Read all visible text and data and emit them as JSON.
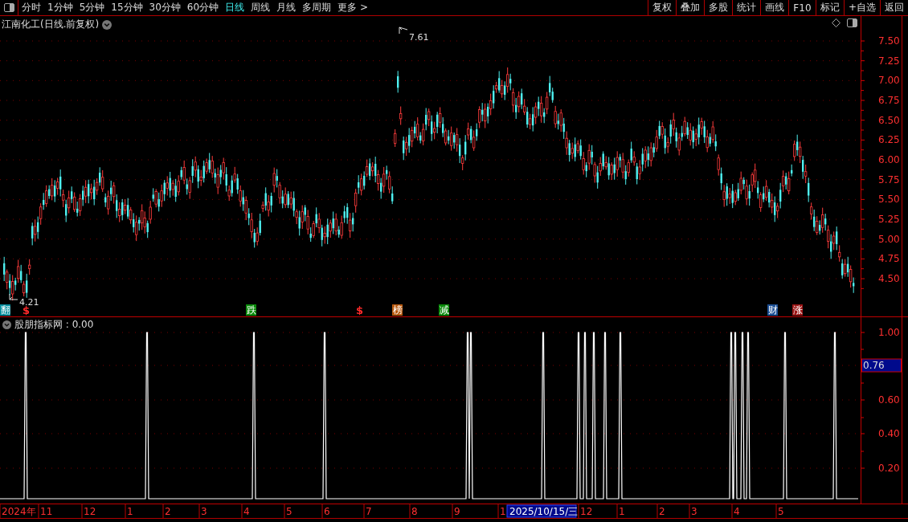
{
  "toolbar": {
    "periods": [
      {
        "label": "分时",
        "selected": false
      },
      {
        "label": "1分钟",
        "selected": false
      },
      {
        "label": "5分钟",
        "selected": false
      },
      {
        "label": "15分钟",
        "selected": false
      },
      {
        "label": "30分钟",
        "selected": false
      },
      {
        "label": "60分钟",
        "selected": false
      },
      {
        "label": "日线",
        "selected": true
      },
      {
        "label": "周线",
        "selected": false
      },
      {
        "label": "月线",
        "selected": false
      },
      {
        "label": "多周期",
        "selected": false
      },
      {
        "label": "更多 >",
        "selected": false
      }
    ],
    "buttons": [
      "复权",
      "叠加",
      "多股",
      "统计",
      "画线",
      "F10",
      "标记",
      "+自选",
      "返回"
    ]
  },
  "price_chart": {
    "title": "江南化工(日线.前复权)",
    "high_label": "7.61",
    "low_label": "4.21",
    "axis_labels": [
      "7.50",
      "7.25",
      "7.00",
      "6.75",
      "6.50",
      "6.25",
      "6.00",
      "5.75",
      "5.50",
      "5.25",
      "5.00",
      "4.75",
      "4.50"
    ],
    "signals": [
      {
        "label": "翻",
        "kind": "tag",
        "color": "#008c9c"
      },
      {
        "label": "$",
        "kind": "symbol",
        "color": "#ff2a2a"
      },
      {
        "label": "跌",
        "kind": "tag",
        "color": "#0a8a0a"
      },
      {
        "label": "$",
        "kind": "symbol",
        "color": "#ff2a2a"
      },
      {
        "label": "榜",
        "kind": "tag",
        "color": "#b85a10"
      },
      {
        "label": "减",
        "kind": "tag",
        "color": "#0a8a0a"
      },
      {
        "label": "财",
        "kind": "tag",
        "color": "#1c4f94"
      },
      {
        "label": "涨",
        "kind": "tag",
        "color": "#9a1414"
      }
    ]
  },
  "indicator": {
    "title": "股朋指标网 : 0.00",
    "current_value": "0.76",
    "axis_labels": [
      "1.00",
      "0.60",
      "0.40",
      "0.20"
    ]
  },
  "date_axis": {
    "labels": [
      "2024年",
      "11",
      "12",
      "1",
      "2",
      "3",
      "4",
      "5",
      "6",
      "7",
      "8",
      "9",
      "1",
      "12",
      "1",
      "2",
      "3",
      "4",
      "5"
    ],
    "cursor_date": "2025/10/15/三"
  }
}
